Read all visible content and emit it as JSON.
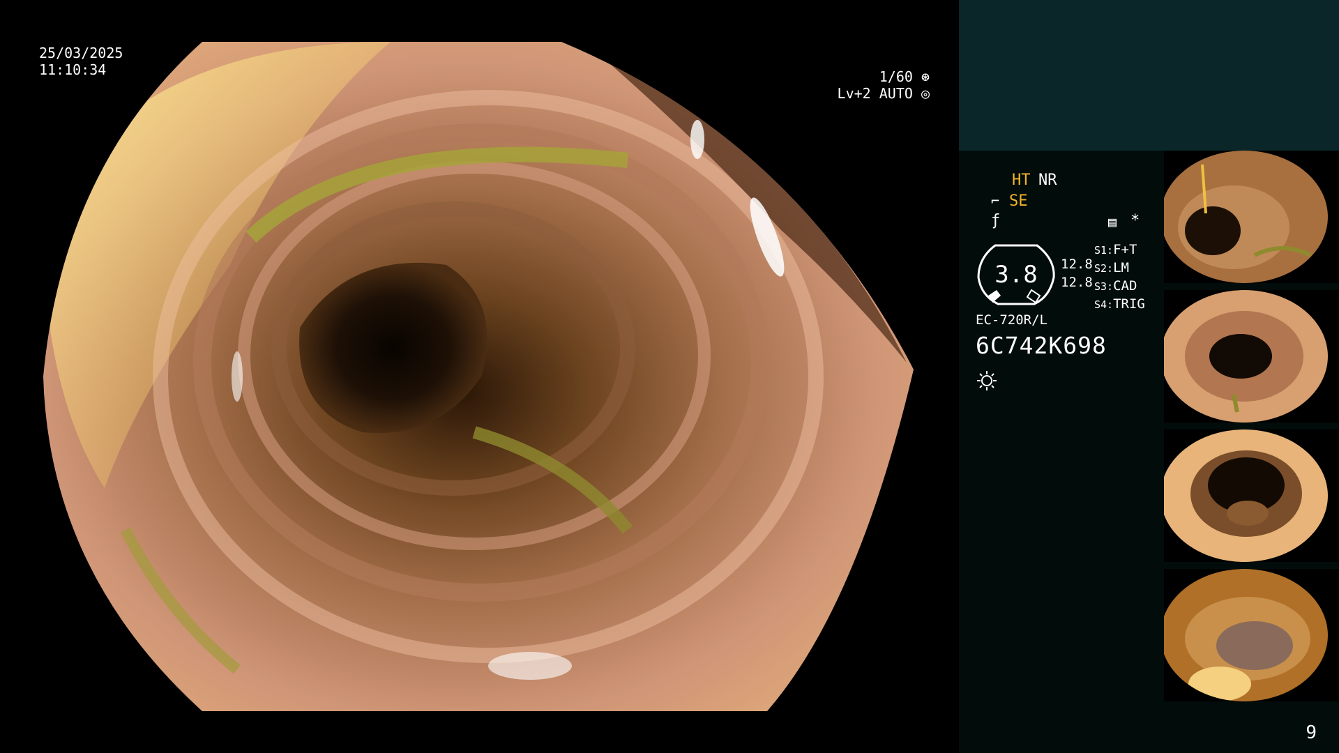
{
  "main": {
    "date": "25/03/2025",
    "time": "11:10:34",
    "shutter": "1/60",
    "level_mode": "Lv+2 AUTO"
  },
  "panel": {
    "mode_ht": "HT",
    "mode_nr": "NR",
    "mode_se": "SE",
    "gauge_value": "3.8",
    "value_upper": "12.8",
    "value_lower": "12.8",
    "soft_keys": [
      {
        "key": "S1:",
        "label": "F+T"
      },
      {
        "key": "S2:",
        "label": "LM"
      },
      {
        "key": "S3:",
        "label": "CAD"
      },
      {
        "key": "S4:",
        "label": "TRIG"
      }
    ],
    "scope_model": "EC-720R/L",
    "scope_serial": "6C742K698",
    "page_number": "9"
  },
  "colors": {
    "panel_bg": "#020c0b",
    "panel_header": "#0a2628",
    "accent_yellow": "#f3b52a",
    "mucosa": "#c98a6a",
    "bile": "#a6a23a"
  },
  "thumbnails": [
    {
      "index": 1
    },
    {
      "index": 2
    },
    {
      "index": 3
    },
    {
      "index": 4
    }
  ]
}
